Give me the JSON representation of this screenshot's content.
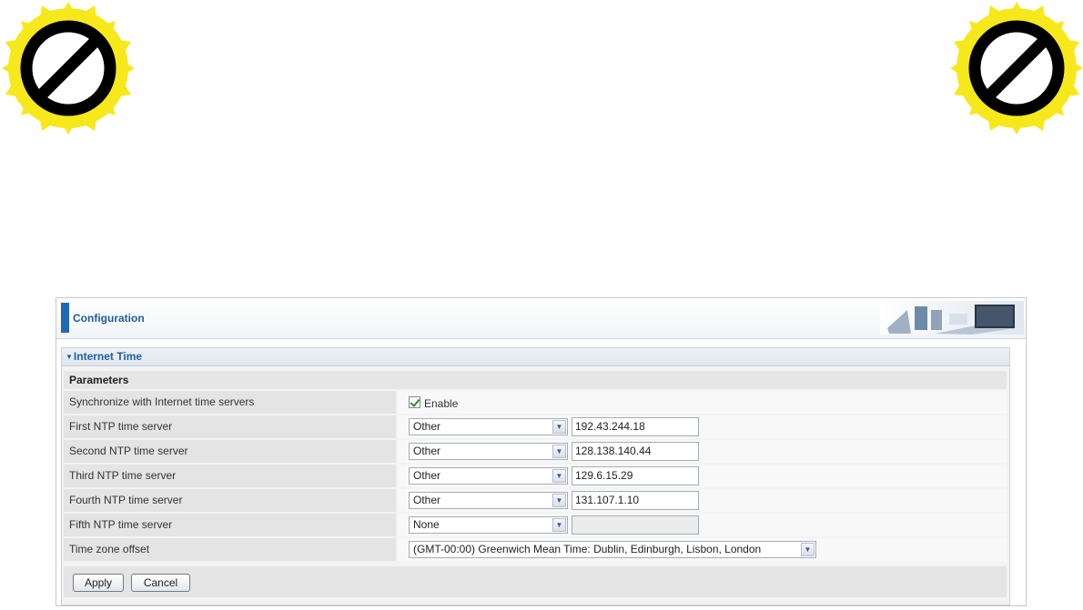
{
  "header": {
    "title": "Configuration"
  },
  "section": {
    "title": "Internet Time"
  },
  "params": {
    "title": "Parameters"
  },
  "sync": {
    "label": "Synchronize with Internet time servers",
    "checkbox_label": "Enable",
    "checked": true
  },
  "ntp": [
    {
      "label": "First NTP time server",
      "selected": "Other",
      "value": "192.43.244.18"
    },
    {
      "label": "Second NTP time server",
      "selected": "Other",
      "value": "128.138.140.44"
    },
    {
      "label": "Third NTP time server",
      "selected": "Other",
      "value": "129.6.15.29"
    },
    {
      "label": "Fourth NTP time server",
      "selected": "Other",
      "value": "131.107.1.10"
    },
    {
      "label": "Fifth NTP time server",
      "selected": "None",
      "value": ""
    }
  ],
  "timezone": {
    "label": "Time zone offset",
    "selected": "(GMT-00:00) Greenwich Mean Time: Dublin, Edinburgh, Lisbon, London"
  },
  "buttons": {
    "apply": "Apply",
    "cancel": "Cancel"
  },
  "colors": {
    "accent": "#1f69b4",
    "badge_yellow": "#f7e81c",
    "badge_black": "#000000"
  }
}
